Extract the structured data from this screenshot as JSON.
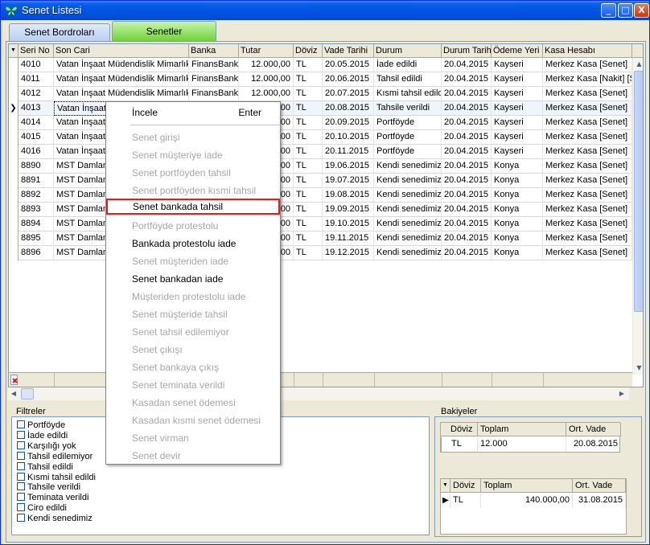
{
  "window": {
    "title": "Senet Listesi"
  },
  "window_buttons": {
    "minimize": "_",
    "maximize": "□",
    "close": "X"
  },
  "tabs": [
    {
      "label": "Senet Bordroları"
    },
    {
      "label": "Senetler"
    }
  ],
  "grid": {
    "columns": [
      "Seri No",
      "Son Cari",
      "Banka",
      "Tutar",
      "Döviz",
      "Vade Tarihi",
      "Durum",
      "Durum Tarih",
      "Ödeme Yeri",
      "Kasa Hesabı"
    ],
    "rows": [
      {
        "seri": "4010",
        "cari": "Vatan İnşaat Müdendislik Mimarlık",
        "banka": "FinansBank",
        "tutar": "12.000,00",
        "doviz": "TL",
        "vade": "20.05.2015",
        "durum": "İade edildi",
        "durum_tarih": "20.04.2015",
        "odeme": "Kayseri",
        "kasa": "Merkez Kasa [Senet]"
      },
      {
        "seri": "4011",
        "cari": "Vatan İnşaat Müdendislik Mimarlık",
        "banka": "FinansBank",
        "tutar": "12.000,00",
        "doviz": "TL",
        "vade": "20.06.2015",
        "durum": "Tahsil edildi",
        "durum_tarih": "20.04.2015",
        "odeme": "Kayseri",
        "kasa": "Merkez Kasa [Nakit] [Senet]"
      },
      {
        "seri": "4012",
        "cari": "Vatan İnşaat Müdendislik Mimarlık",
        "banka": "FinansBank",
        "tutar": "12.000,00",
        "doviz": "TL",
        "vade": "20.07.2015",
        "durum": "Kısmi tahsil edildi",
        "durum_tarih": "20.04.2015",
        "odeme": "Kayseri",
        "kasa": "Merkez Kasa [Senet]"
      },
      {
        "seri": "4013",
        "cari": "Vatan İnşaat",
        "banka": "",
        "tutar": "00",
        "doviz": "TL",
        "vade": "20.08.2015",
        "durum": "Tahsile verildi",
        "durum_tarih": "20.04.2015",
        "odeme": "Kayseri",
        "kasa": "Merkez Kasa [Senet]"
      },
      {
        "seri": "4014",
        "cari": "Vatan İnşaat",
        "banka": "",
        "tutar": "00",
        "doviz": "TL",
        "vade": "20.09.2015",
        "durum": "Portföyde",
        "durum_tarih": "20.04.2015",
        "odeme": "Kayseri",
        "kasa": "Merkez Kasa [Senet]"
      },
      {
        "seri": "4015",
        "cari": "Vatan İnşaat",
        "banka": "",
        "tutar": "00",
        "doviz": "TL",
        "vade": "20.10.2015",
        "durum": "Portföyde",
        "durum_tarih": "20.04.2015",
        "odeme": "Kayseri",
        "kasa": "Merkez Kasa [Senet]"
      },
      {
        "seri": "4016",
        "cari": "Vatan İnşaat",
        "banka": "",
        "tutar": "00",
        "doviz": "TL",
        "vade": "20.11.2015",
        "durum": "Portföyde",
        "durum_tarih": "20.04.2015",
        "odeme": "Kayseri",
        "kasa": "Merkez Kasa [Senet]"
      },
      {
        "seri": "8890",
        "cari": "MST Damlam",
        "banka": "",
        "tutar": "00",
        "doviz": "TL",
        "vade": "19.06.2015",
        "durum": "Kendi senedimiz",
        "durum_tarih": "20.04.2015",
        "odeme": "Konya",
        "kasa": "Merkez Kasa [Senet]"
      },
      {
        "seri": "8891",
        "cari": "MST Damlam",
        "banka": "",
        "tutar": "00",
        "doviz": "TL",
        "vade": "19.07.2015",
        "durum": "Kendi senedimiz",
        "durum_tarih": "20.04.2015",
        "odeme": "Konya",
        "kasa": "Merkez Kasa [Senet]"
      },
      {
        "seri": "8892",
        "cari": "MST Damlam",
        "banka": "",
        "tutar": "00",
        "doviz": "TL",
        "vade": "19.08.2015",
        "durum": "Kendi senedimiz",
        "durum_tarih": "20.04.2015",
        "odeme": "Konya",
        "kasa": "Merkez Kasa [Senet]"
      },
      {
        "seri": "8893",
        "cari": "MST Damlam",
        "banka": "",
        "tutar": "00",
        "doviz": "TL",
        "vade": "19.09.2015",
        "durum": "Kendi senedimiz",
        "durum_tarih": "20.04.2015",
        "odeme": "Konya",
        "kasa": "Merkez Kasa [Senet]"
      },
      {
        "seri": "8894",
        "cari": "MST Damlam",
        "banka": "",
        "tutar": "00",
        "doviz": "TL",
        "vade": "19.10.2015",
        "durum": "Kendi senedimiz",
        "durum_tarih": "20.04.2015",
        "odeme": "Konya",
        "kasa": "Merkez Kasa [Senet]"
      },
      {
        "seri": "8895",
        "cari": "MST Damlam",
        "banka": "",
        "tutar": "00",
        "doviz": "TL",
        "vade": "19.11.2015",
        "durum": "Kendi senedimiz",
        "durum_tarih": "20.04.2015",
        "odeme": "Konya",
        "kasa": "Merkez Kasa [Senet]"
      },
      {
        "seri": "8896",
        "cari": "MST Damlam",
        "banka": "",
        "tutar": "00",
        "doviz": "TL",
        "vade": "19.12.2015",
        "durum": "Kendi senedimiz",
        "durum_tarih": "20.04.2015",
        "odeme": "Konya",
        "kasa": "Merkez Kasa [Senet]"
      }
    ],
    "selected_row": "4013"
  },
  "filters": {
    "title": "Filtreler",
    "items": [
      "Portföyde",
      "İade edildi",
      "Karşılığı yok",
      "Tahsil edilemiyor",
      "Tahsil edildi",
      "Kısmi tahsil edildi",
      "Tahsile verildi",
      "Teminata verildi",
      "Ciro edildi",
      "Kendi senedimiz"
    ]
  },
  "balances": {
    "title": "Bakiyeler",
    "top": {
      "columns": [
        "Döviz",
        "Toplam",
        "Ort. Vade"
      ],
      "row": {
        "doviz": "TL",
        "toplam": "12.000",
        "ort_vade": "20.08.2015"
      }
    },
    "bottom": {
      "columns": [
        "Döviz",
        "Toplam",
        "Ort. Vade"
      ],
      "row": {
        "doviz": "TL",
        "toplam": "140.000,00",
        "ort_vade": "31.08.2015"
      }
    }
  },
  "context_menu": {
    "items": [
      {
        "label": "İncele",
        "shortcut": "Enter",
        "enabled": true
      },
      {
        "label": "Senet girişi",
        "enabled": false
      },
      {
        "label": "Senet müşteriye iade",
        "enabled": false
      },
      {
        "label": "Senet portföyden tahsil",
        "enabled": false
      },
      {
        "label": "Senet portföyden kısmi tahsil",
        "enabled": false
      },
      {
        "label": "Senet bankada tahsil",
        "enabled": true,
        "highlighted": true
      },
      {
        "label": "Portföyde protestolu",
        "enabled": false
      },
      {
        "label": "Bankada protestolu iade",
        "enabled": true
      },
      {
        "label": "Senet müşteriden iade",
        "enabled": false
      },
      {
        "label": "Senet bankadan iade",
        "enabled": true
      },
      {
        "label": "Müşteriden protestolu iade",
        "enabled": false
      },
      {
        "label": "Senet müşteride tahsil",
        "enabled": false
      },
      {
        "label": "Senet tahsil edilemiyor",
        "enabled": false
      },
      {
        "label": "Senet çıkışı",
        "enabled": false
      },
      {
        "label": "Senet bankaya çıkış",
        "enabled": false
      },
      {
        "label": "Senet teminata verildi",
        "enabled": false
      },
      {
        "label": "Kasadan senet ödemesi",
        "enabled": false
      },
      {
        "label": "Kasadan kısmi senet ödemesi",
        "enabled": false
      },
      {
        "label": "Senet virman",
        "enabled": false
      },
      {
        "label": "Senet devir",
        "enabled": false
      }
    ]
  }
}
